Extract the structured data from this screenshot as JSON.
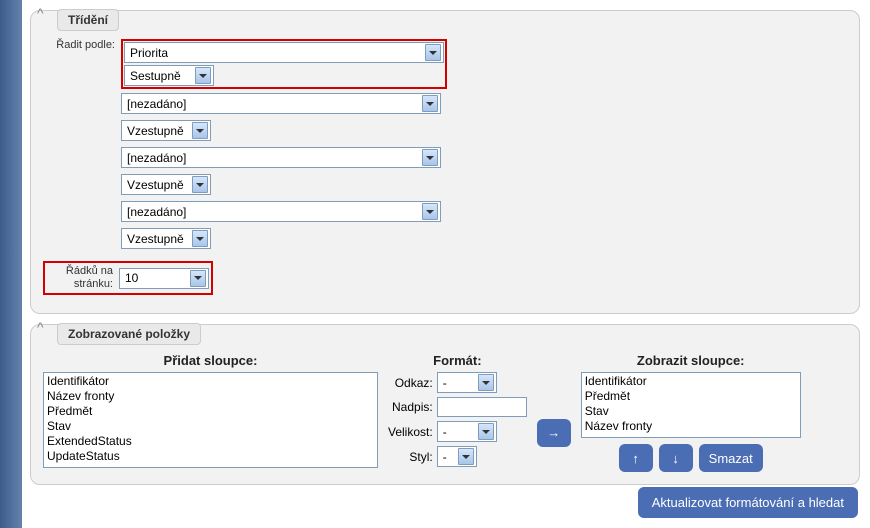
{
  "sorting": {
    "title": "Třídění",
    "sort_by_label": "Řadit podle:",
    "rows_per_page_label": "Řádků na stránku:",
    "criteria": [
      {
        "field": "Priorita",
        "direction": "Sestupně"
      },
      {
        "field": "[nezadáno]",
        "direction": "Vzestupně"
      },
      {
        "field": "[nezadáno]",
        "direction": "Vzestupně"
      },
      {
        "field": "[nezadáno]",
        "direction": "Vzestupně"
      }
    ],
    "rows_per_page": "10"
  },
  "columns": {
    "title": "Zobrazované položky",
    "add_header": "Přidat sloupce:",
    "format_header": "Formát:",
    "show_header": "Zobrazit sloupce:",
    "add_list": [
      "Identifikátor",
      "Název fronty",
      "Předmět",
      "Stav",
      "ExtendedStatus",
      "UpdateStatus"
    ],
    "show_list": [
      "Identifikátor",
      "Předmět",
      "Stav",
      "Název fronty"
    ],
    "format": {
      "link_label": "Odkaz:",
      "title_label": "Nadpis:",
      "size_label": "Velikost:",
      "style_label": "Styl:",
      "link_value": "-",
      "title_value": "",
      "size_value": "-",
      "style_value": "-"
    },
    "move_right": "→",
    "up": "↑",
    "down": "↓",
    "delete": "Smazat"
  },
  "submit": "Aktualizovat formátování a hledat"
}
